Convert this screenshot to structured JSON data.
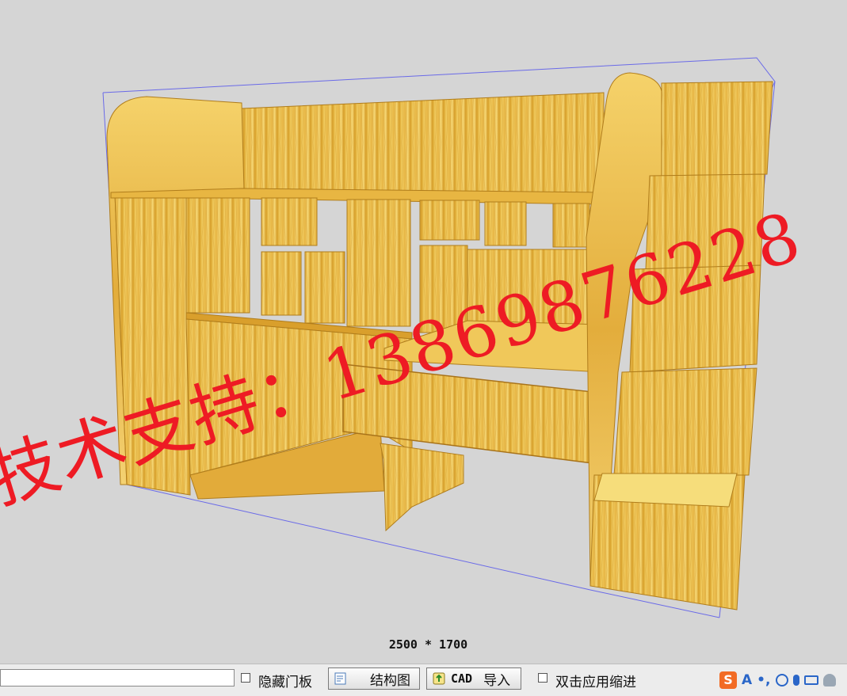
{
  "viewport": {
    "dimensions_label": "2500 * 1700",
    "watermark_text": "技术支持：13869876228"
  },
  "toolbar": {
    "input_value": "",
    "hide_door_panels_label": "隐藏门板",
    "structure_button_label": "结构图",
    "cad_import_cad": "CAD",
    "cad_import_label": "导入",
    "double_click_indent_label": "双击应用缩进"
  },
  "ime_tray": {
    "items": [
      "sogou-s-logo-icon",
      "font-A-icon",
      "punctuation-icon",
      "emoji-icon",
      "microphone-icon",
      "keyboard-icon",
      "user-icon"
    ],
    "brand_color": "#f26b24"
  },
  "colors": {
    "wood_light": "#f2cb5a",
    "wood_dark": "#c98d1a",
    "bounding_box": "#6a6ae8",
    "watermark": "#ee1b24"
  }
}
